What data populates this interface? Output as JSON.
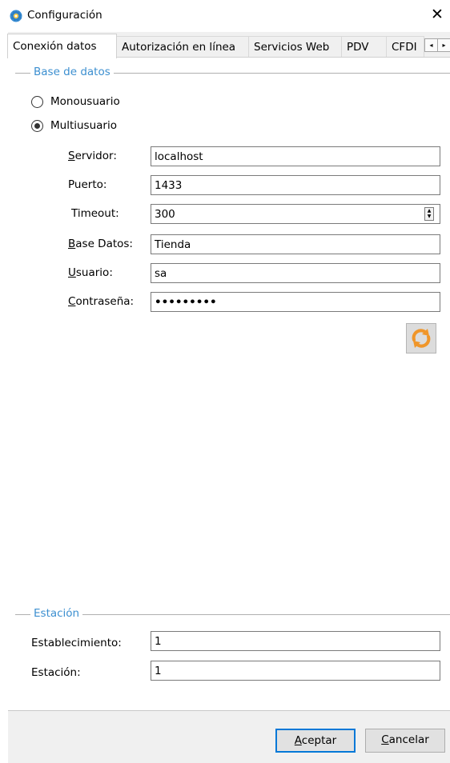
{
  "window": {
    "title": "Configuración",
    "close_glyph": "✕",
    "icon": "settings-gear-icon"
  },
  "tabs": [
    {
      "label": "Conexión datos",
      "active": true
    },
    {
      "label": "Autorización en línea",
      "active": false
    },
    {
      "label": "Servicios Web",
      "active": false
    },
    {
      "label": "PDV",
      "active": false
    },
    {
      "label": "CFDI",
      "active": false
    }
  ],
  "tab_scroll": {
    "left": "◂",
    "right": "▸"
  },
  "database_group": {
    "title": "Base de datos",
    "mode_options": [
      {
        "label": "Monousuario",
        "selected": false
      },
      {
        "label": "Multiusuario",
        "selected": true
      }
    ],
    "fields": {
      "server": {
        "label_first": "S",
        "label_rest": "ervidor:",
        "value": "localhost"
      },
      "port": {
        "label": "Puerto:",
        "value": "1433"
      },
      "timeout": {
        "label": "Timeout:",
        "value": "300"
      },
      "database": {
        "label_first": "B",
        "label_rest": "ase Datos:",
        "value": "Tienda"
      },
      "user": {
        "label_first": "U",
        "label_rest": "suario:",
        "value": "sa"
      },
      "password": {
        "label_first": "C",
        "label_rest": "ontraseña:",
        "value": "•••••••••"
      }
    },
    "refresh_icon": "refresh-icon"
  },
  "station_group": {
    "title": "Estación",
    "fields": {
      "establishment": {
        "label": "Establecimiento:",
        "value": "1"
      },
      "station": {
        "label": "Estación:",
        "value": "1"
      }
    }
  },
  "buttons": {
    "accept": {
      "first": "A",
      "rest": "ceptar"
    },
    "cancel": {
      "first": "C",
      "rest": "ancelar"
    }
  },
  "colors": {
    "group_title": "#3c8fd0",
    "default_button_border": "#0078d7",
    "refresh_orange": "#f0962a"
  }
}
